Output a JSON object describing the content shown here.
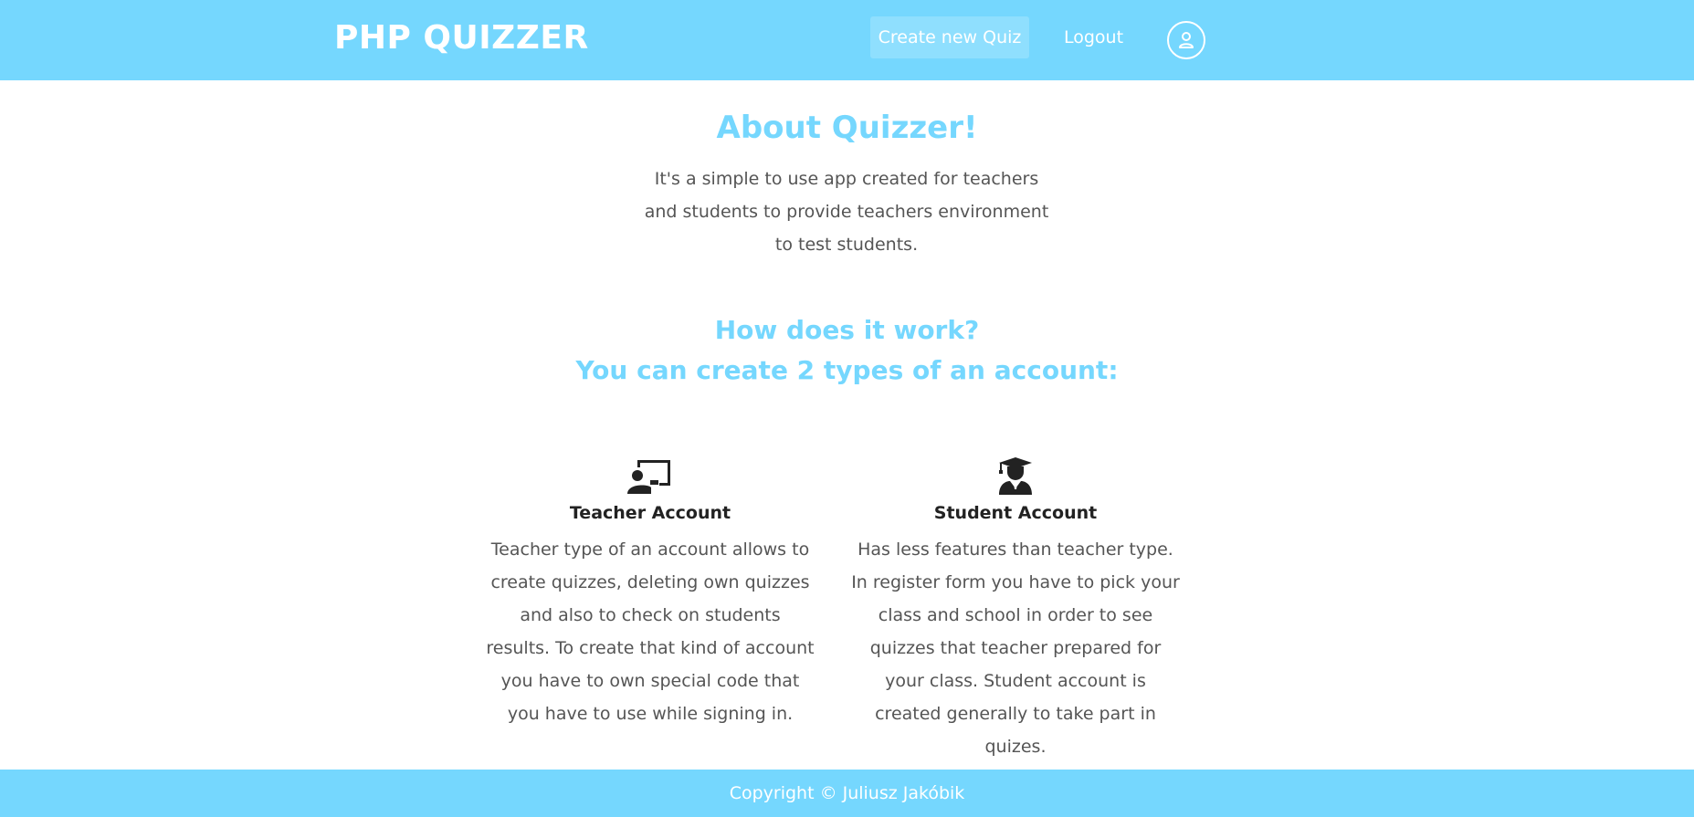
{
  "header": {
    "brand": "PHP QUIZZER",
    "create_quiz_label": "Create new Quiz",
    "logout_label": "Logout",
    "profile_icon": "user-circle-icon"
  },
  "about": {
    "title": "About Quizzer!",
    "text": "It's a simple to use app created for teachers and students to provide teachers environment to test students."
  },
  "how": {
    "line1": "How does it work?",
    "line2": "You can create 2 types of an account:"
  },
  "accounts": {
    "teacher": {
      "icon": "chalkboard-teacher-icon",
      "title": "Teacher Account",
      "text": "Teacher type of an account allows to create quizzes, deleting own quizzes and also to check on students results. To create that kind of account you have to own special code that you have to use while signing in."
    },
    "student": {
      "icon": "user-graduate-icon",
      "title": "Student Account",
      "text": "Has less features than teacher type. In register form you have to pick your class and school in order to see quizzes that teacher prepared for your class. Student account is created generally to take part in quizes."
    }
  },
  "footer": {
    "copyright": "Copyright © Juliusz Jakóbik"
  },
  "colors": {
    "accent": "#75d7fe",
    "button_bg": "#8fdffe",
    "text": "#555555",
    "heading_dark": "#222222"
  }
}
